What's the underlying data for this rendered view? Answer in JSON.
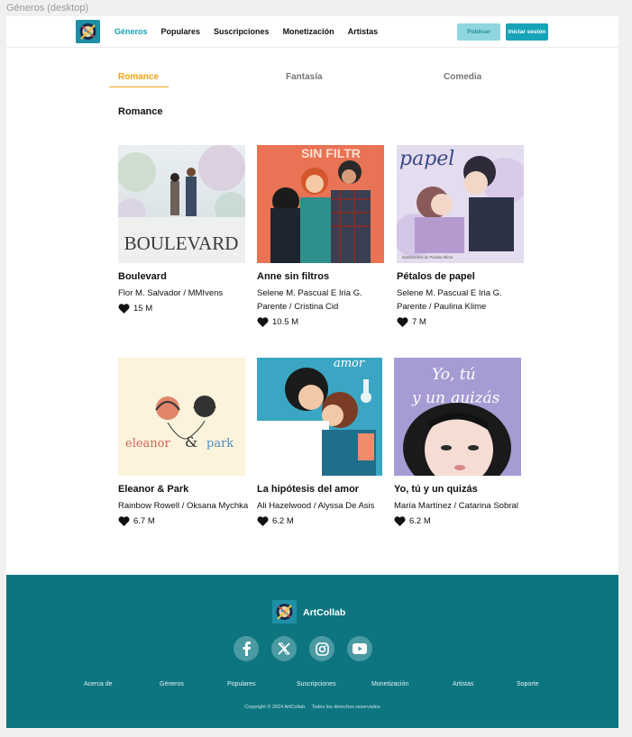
{
  "frame_label": "Géneros (desktop)",
  "nav": {
    "items": [
      "Géneros",
      "Populares",
      "Suscripciones",
      "Monetización",
      "Artistas"
    ],
    "active": "Géneros",
    "publish_label": "Publicar",
    "login_label": "Iniciar sesión"
  },
  "tabs": [
    {
      "label": "Romance",
      "active": true
    },
    {
      "label": "Fantasía",
      "active": false
    },
    {
      "label": "Comedia",
      "active": false
    }
  ],
  "section_title": "Romance",
  "books": [
    {
      "title": "Boulevard",
      "author": "Flor M. Salvador / MMIvens",
      "likes": "15 M",
      "cover_text": "BOULEVARD"
    },
    {
      "title": "Anne sin filtros",
      "author": "Selene M. Pascual E Iria G. Parente / Cristina Cid",
      "likes": "10.5 M",
      "cover_text": "SIN FILTR"
    },
    {
      "title": "Pétalos de papel",
      "author": "Selene M. Pascual E Iria G. Parente / Paulina Klime",
      "likes": "7 M",
      "cover_text": "papel",
      "cover_subtext": "Ilustraciones de Paulina Klime"
    },
    {
      "title": "Eleanor & Park",
      "author": "Rainbow Rowell / Oksana Mychka",
      "likes": "6.7 M",
      "cover_text_left": "eleanor",
      "cover_text_amp": "&",
      "cover_text_right": "park"
    },
    {
      "title": "La hipótesis del amor",
      "author": "Ali Hazelwood / Alyssa De Asis",
      "likes": "6.2 M",
      "cover_text": "amor"
    },
    {
      "title": "Yo, tú y un quizás",
      "author": "María Martínez / Catarina Sobral",
      "likes": "6.2 M",
      "cover_text_1": "Yo, tú",
      "cover_text_2": "y un quizás"
    }
  ],
  "footer": {
    "brand": "ArtCollab",
    "social_icons": [
      "facebook-icon",
      "x-icon",
      "instagram-icon",
      "youtube-icon"
    ],
    "links": [
      "Acerca de",
      "Géneros",
      "Populares",
      "Suscripciones",
      "Monetización",
      "Artistas",
      "Soporte"
    ],
    "copyright": "Copyright © 2024 ArtCollab.    Todos los derechos reservados"
  },
  "colors": {
    "accent": "#17a3b8",
    "tab_active": "#f0a11a",
    "footer_bg": "#0d7580"
  }
}
